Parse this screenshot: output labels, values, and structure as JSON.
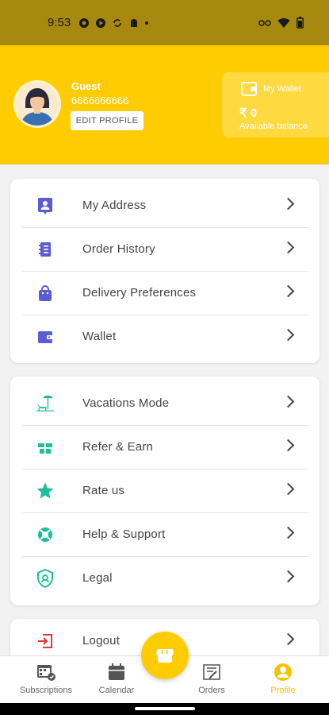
{
  "status_bar": {
    "time": "9:53"
  },
  "profile": {
    "name": "Guest",
    "phone": "6666666666",
    "edit_label": "EDIT PROFILE"
  },
  "wallet": {
    "title": "My Wallet",
    "amount": "₹ 0",
    "subtitle": "Available balance"
  },
  "menu_primary": [
    {
      "label": "My Address",
      "icon": "address-icon"
    },
    {
      "label": "Order History",
      "icon": "order-history-icon"
    },
    {
      "label": "Delivery Preferences",
      "icon": "delivery-bag-icon"
    },
    {
      "label": "Wallet",
      "icon": "wallet-icon"
    }
  ],
  "menu_secondary": [
    {
      "label": "Vacations Mode",
      "icon": "beach-chair-icon"
    },
    {
      "label": "Refer & Earn",
      "icon": "gift-icon"
    },
    {
      "label": "Rate us",
      "icon": "star-icon"
    },
    {
      "label": "Help & Support",
      "icon": "lifebuoy-icon"
    },
    {
      "label": "Legal",
      "icon": "shield-icon"
    }
  ],
  "logout_label": "Logout",
  "bottom_nav": {
    "subscriptions": "Subscriptions",
    "calendar": "Calendar",
    "orders": "Orders",
    "profile": "Profile"
  },
  "colors": {
    "brand": "#fecc00",
    "primary_icon": "#5b5bd6",
    "secondary_icon": "#1ebf96",
    "logout_icon": "#e53935"
  }
}
